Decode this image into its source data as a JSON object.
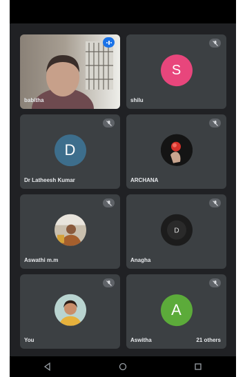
{
  "colors": {
    "background": "#202124",
    "tile": "#3c4043",
    "speaking_indicator": "#1a73e8",
    "avatar_shilu": "#e8467c",
    "avatar_latheesh": "#3d6e8c",
    "avatar_aswitha": "#5cab3a"
  },
  "participants": [
    {
      "name": "babitha",
      "kind": "video",
      "speaking": true
    },
    {
      "name": "shilu",
      "kind": "initial",
      "initial": "S",
      "muted": true
    },
    {
      "name": "Dr Latheesh Kumar",
      "kind": "initial",
      "initial": "D",
      "muted": true
    },
    {
      "name": "ARCHANA",
      "kind": "photo",
      "muted": true
    },
    {
      "name": "Aswathi m.m",
      "kind": "photo",
      "muted": true
    },
    {
      "name": "Anagha",
      "kind": "photo",
      "muted": true
    },
    {
      "name": "You",
      "kind": "photo",
      "muted": true
    },
    {
      "name": "Aswitha",
      "kind": "initial",
      "initial": "A",
      "muted": true
    }
  ],
  "others_label": "21 others",
  "icons": {
    "muted": "mic-off-icon",
    "speaking": "audio-level-icon",
    "nav_back": "back-triangle-icon",
    "nav_home": "home-circle-icon",
    "nav_recents": "recents-square-icon"
  }
}
